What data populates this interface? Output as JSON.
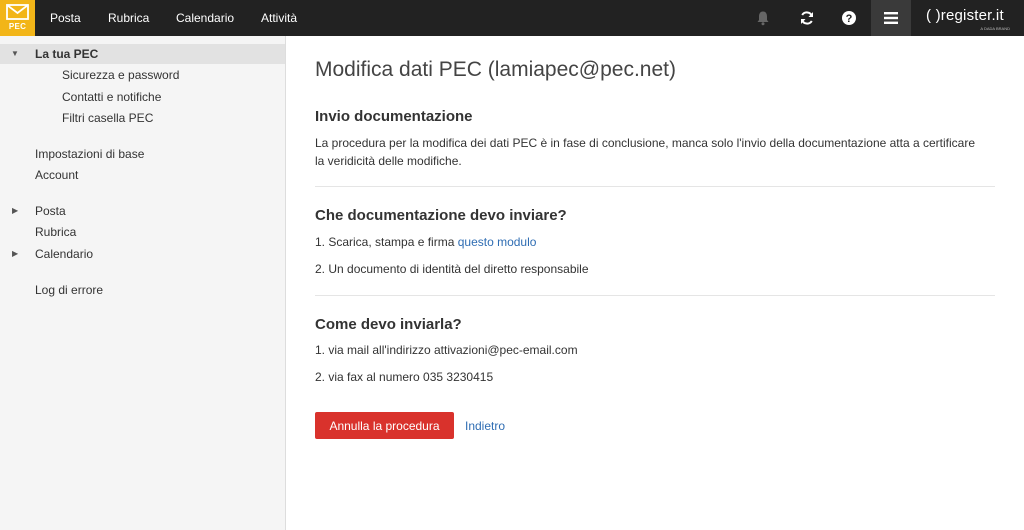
{
  "app": {
    "logo_text": "PEC"
  },
  "topnav": {
    "items": [
      "Posta",
      "Rubrica",
      "Calendario",
      "Attività"
    ]
  },
  "brand": {
    "main": "( )register.it",
    "sub": "A DADA BRAND"
  },
  "icons": {
    "notifications": "bell-icon",
    "refresh": "refresh-icon",
    "help": "help-icon",
    "menu": "hamburger-menu-icon"
  },
  "colors": {
    "topbar": "#222222",
    "logo": "#f2b518",
    "danger": "#d9322c",
    "link": "#2f6db3"
  },
  "sidebar": {
    "section": "La tua PEC",
    "sub_items": [
      "Sicurezza e password",
      "Contatti e notifiche",
      "Filtri casella PEC"
    ],
    "settings": [
      "Impostazioni di base",
      "Account"
    ],
    "folders": [
      "Posta",
      "Rubrica",
      "Calendario"
    ],
    "log": "Log di errore"
  },
  "main": {
    "title": "Modifica dati PEC (lamiapec@pec.net)",
    "section1": {
      "heading": "Invio documentazione",
      "text": "La procedura per la modifica dei dati PEC è in fase di conclusione, manca solo l'invio della documentazione atta a certificare la veridicità delle modifiche."
    },
    "section2": {
      "heading": "Che documentazione devo inviare?",
      "item1_prefix": "1. Scarica, stampa e firma ",
      "item1_link": "questo modulo",
      "item2": "2. Un documento di identità del diretto responsabile"
    },
    "section3": {
      "heading": "Come devo inviarla?",
      "item1": "1. via mail all'indirizzo attivazioni@pec-email.com",
      "item2": "2. via fax al numero 035 3230415"
    },
    "cancel_button": "Annulla la procedura",
    "back_link": "Indietro"
  }
}
